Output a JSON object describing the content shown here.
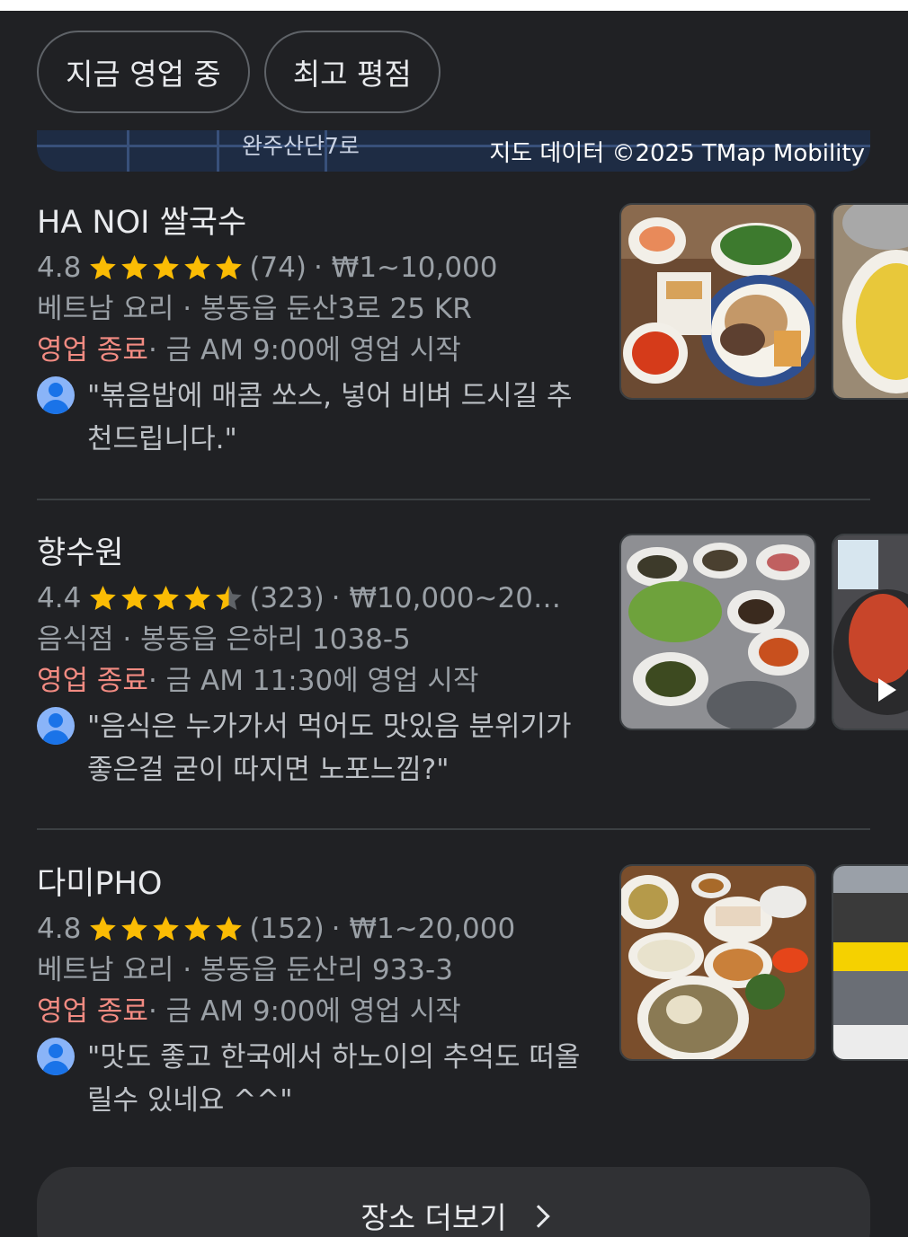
{
  "filters": [
    {
      "label": "지금 영업 중"
    },
    {
      "label": "최고 평점"
    }
  ],
  "map": {
    "road_label": "완주산단7로",
    "credit": "지도 데이터 ©2025 TMap Mobility"
  },
  "places": [
    {
      "name": "HA NOI 쌀국수",
      "rating": "4.8",
      "stars": 5,
      "reviews_count": "(74)",
      "price": "₩1~10,000",
      "category_address": "베트남 요리 · 봉동읍 둔산3로 25 KR",
      "status": "영업 종료",
      "hours": " · 금 AM 9:00에 영업 시작",
      "review": "\"볶음밥에 매콤 쏘스, 넣어 비벼 드시길 추천드립니다.\""
    },
    {
      "name": "향수원",
      "rating": "4.4",
      "stars": 4.5,
      "reviews_count": "(323)",
      "price": "₩10,000~20,…",
      "category_address": "음식점 · 봉동읍 은하리 1038-5",
      "status": "영업 종료",
      "hours": " · 금 AM 11:30에 영업 시작",
      "review": "\"음식은 누가가서 먹어도 맛있음 분위기가 좋은걸 굳이 따지면 노포느낌?\""
    },
    {
      "name": "다미PHO",
      "rating": "4.8",
      "stars": 5,
      "reviews_count": "(152)",
      "price": "₩1~20,000",
      "category_address": "베트남 요리 · 봉동읍 둔산리 933-3",
      "status": "영업 종료",
      "hours": " · 금 AM 9:00에 영업 시작",
      "review": "\"맛도 좋고 한국에서 하노이의 추억도 떠올릴수 있네요 ^^\""
    }
  ],
  "more_button": {
    "label": "장소 더보기"
  },
  "colors": {
    "background": "#202124",
    "star": "#fbbc04",
    "closed": "#f28b82",
    "avatar": "#8ab4f8"
  },
  "icons": {
    "star": "star-icon",
    "avatar": "user-avatar-icon",
    "play": "play-icon",
    "chevron": "chevron-right-icon"
  }
}
